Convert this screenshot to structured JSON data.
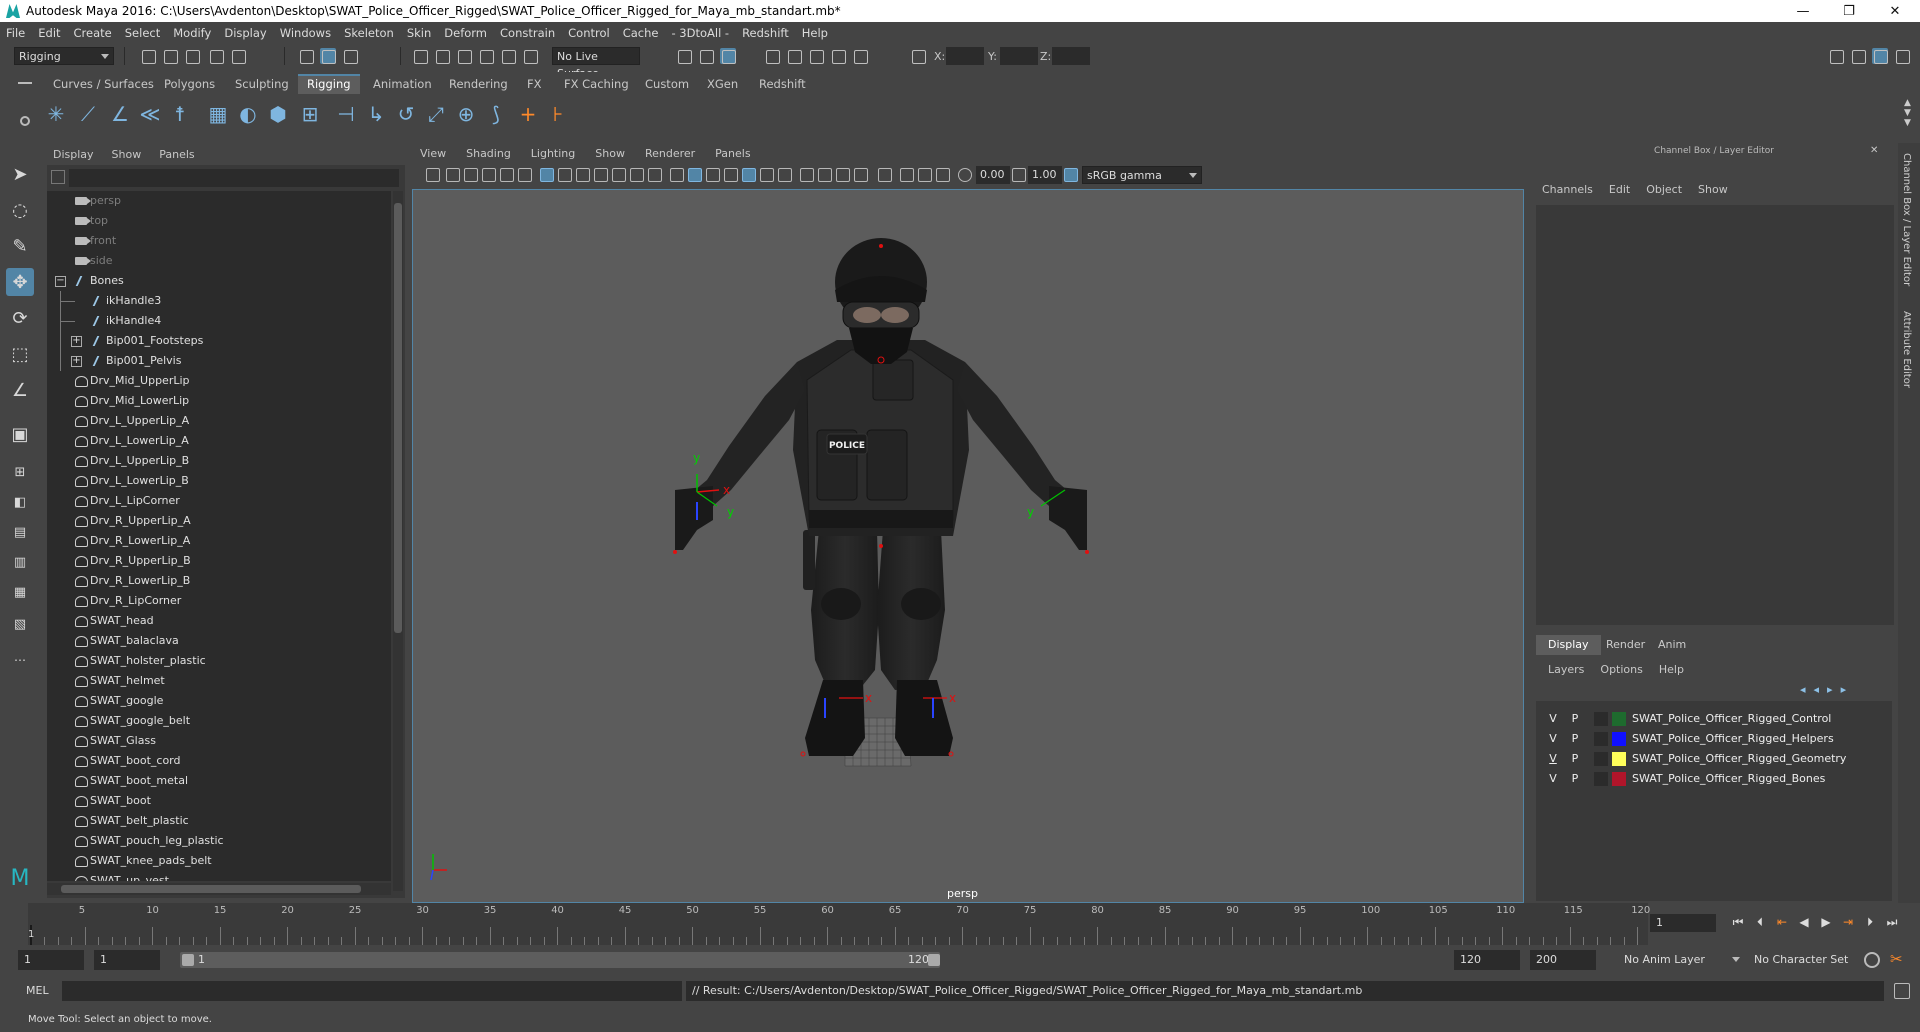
{
  "window": {
    "title": "Autodesk Maya 2016: C:\\Users\\Avdenton\\Desktop\\SWAT_Police_Officer_Rigged\\SWAT_Police_Officer_Rigged_for_Maya_mb_standart.mb*",
    "minimize": "—",
    "maximize": "❐",
    "close": "✕"
  },
  "menubar": [
    "File",
    "Edit",
    "Create",
    "Select",
    "Modify",
    "Display",
    "Windows",
    "Skeleton",
    "Skin",
    "Deform",
    "Constrain",
    "Control",
    "Cache",
    "- 3DtoAll -",
    "Redshift",
    "Help"
  ],
  "statusline": {
    "menuset": "Rigging",
    "live_surface": "No Live Surface",
    "x_label": "X:",
    "y_label": "Y:",
    "z_label": "Z:"
  },
  "shelf": {
    "tabs": [
      "Curves / Surfaces",
      "Polygons",
      "Sculpting",
      "Rigging",
      "Animation",
      "Rendering",
      "FX",
      "FX Caching",
      "Custom",
      "XGen",
      "Redshift"
    ],
    "active_tab": "Rigging"
  },
  "outliner": {
    "menu": [
      "Display",
      "Show",
      "Panels"
    ],
    "cameras": [
      "persp",
      "top",
      "front",
      "side"
    ],
    "bones_group": "Bones",
    "bones_children": [
      "ikHandle3",
      "ikHandle4",
      "Bip001_Footsteps",
      "Bip001_Pelvis"
    ],
    "meshes": [
      "Drv_Mid_UpperLip",
      "Drv_Mid_LowerLip",
      "Drv_L_UpperLip_A",
      "Drv_L_LowerLip_A",
      "Drv_L_UpperLip_B",
      "Drv_L_LowerLip_B",
      "Drv_L_LipCorner",
      "Drv_R_UpperLip_A",
      "Drv_R_LowerLip_A",
      "Drv_R_UpperLip_B",
      "Drv_R_LowerLip_B",
      "Drv_R_LipCorner",
      "SWAT_head",
      "SWAT_balaclava",
      "SWAT_holster_plastic",
      "SWAT_helmet",
      "SWAT_google",
      "SWAT_google_belt",
      "SWAT_Glass",
      "SWAT_boot_cord",
      "SWAT_boot_metal",
      "SWAT_boot",
      "SWAT_belt_plastic",
      "SWAT_pouch_leg_plastic",
      "SWAT_knee_pads_belt",
      "SWAT_up_vest"
    ]
  },
  "viewport": {
    "menu": [
      "View",
      "Shading",
      "Lighting",
      "Show",
      "Renderer",
      "Panels"
    ],
    "exposure": "0.00",
    "gamma": "1.00",
    "colorspace": "sRGB gamma",
    "camera_label": "persp",
    "vest_text": "POLICE",
    "axis_x": "x",
    "axis_y": "y"
  },
  "channelbox": {
    "header": "Channel Box / Layer Editor",
    "menu": [
      "Channels",
      "Edit",
      "Object",
      "Show"
    ]
  },
  "sidetabs": [
    "Channel Box / Layer Editor",
    "Attribute Editor"
  ],
  "layer_editor": {
    "tabs": [
      "Display",
      "Render",
      "Anim"
    ],
    "active_tab": "Display",
    "menu": [
      "Layers",
      "Options",
      "Help"
    ],
    "layers": [
      {
        "v": "V",
        "p": "P",
        "color": "#1e6b2e",
        "name": "SWAT_Police_Officer_Rigged_Control"
      },
      {
        "v": "V",
        "p": "P",
        "color": "#1010ff",
        "name": "SWAT_Police_Officer_Rigged_Helpers"
      },
      {
        "v": "V",
        "p": "P",
        "color": "#ffff5a",
        "name": "SWAT_Police_Officer_Rigged_Geometry"
      },
      {
        "v": "V",
        "p": "P",
        "color": "#b0152a",
        "name": "SWAT_Police_Officer_Rigged_Bones"
      }
    ]
  },
  "timeslider": {
    "tick_labels": [
      "5",
      "10",
      "15",
      "20",
      "25",
      "30",
      "35",
      "40",
      "45",
      "50",
      "55",
      "60",
      "65",
      "70",
      "75",
      "80",
      "85",
      "90",
      "95",
      "100",
      "105",
      "110",
      "115",
      "120"
    ],
    "start_marker": "1",
    "current_frame": "1"
  },
  "range": {
    "start": "1",
    "inner_start": "1",
    "bar_start": "1",
    "bar_end": "120",
    "end": "120",
    "outer_end": "200",
    "anim_layer": "No Anim Layer",
    "character_set": "No Character Set"
  },
  "commandline": {
    "language": "MEL",
    "result": "// Result: C:/Users/Avdenton/Desktop/SWAT_Police_Officer_Rigged/SWAT_Police_Officer_Rigged_for_Maya_mb_standart.mb"
  },
  "helpline": "Move Tool: Select an object to move."
}
